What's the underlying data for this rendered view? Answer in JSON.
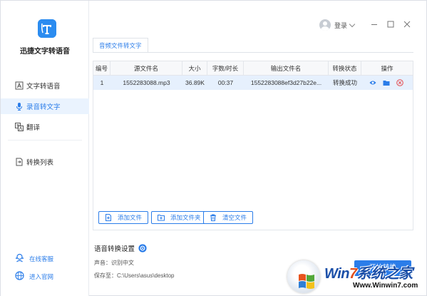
{
  "app": {
    "name": "迅捷文字转语音"
  },
  "sidebar": {
    "items": [
      {
        "label": "文字转语音",
        "icon": "text-to-speech-icon",
        "active": false
      },
      {
        "label": "录音转文字",
        "icon": "microphone-icon",
        "active": true
      },
      {
        "label": "翻译",
        "icon": "translate-icon",
        "active": false
      },
      {
        "label": "转换列表",
        "icon": "conversion-list-icon",
        "active": false
      }
    ],
    "links": [
      {
        "label": "在线客服",
        "icon": "customer-service-icon"
      },
      {
        "label": "进入官网",
        "icon": "globe-icon"
      }
    ]
  },
  "titlebar": {
    "login_label": "登录"
  },
  "tabs": [
    {
      "label": "音频文件转文字"
    }
  ],
  "table": {
    "headers": [
      "编号",
      "源文件名",
      "大小",
      "字数/时长",
      "输出文件名",
      "转换状态",
      "操作"
    ],
    "rows": [
      {
        "id": "1",
        "source": "1552283088.mp3",
        "size": "36.89K",
        "duration": "00:37",
        "output": "1552283088ef3d27b22e...",
        "status": "转换成功"
      }
    ]
  },
  "buttons": {
    "add_file": "添加文件",
    "add_folder": "添加文件夹",
    "clear_files": "清空文件"
  },
  "settings": {
    "title": "语音转换设置",
    "voice_label": "声音：",
    "voice_value": "识别中文",
    "save_label": "保存至：",
    "save_value": "C:\\Users\\asus\\desktop",
    "start_label": "开始转换"
  },
  "watermark": {
    "brand_a": "Win",
    "brand_b": "7",
    "brand_c": "系统之家",
    "url": "Www.Winwin7.com"
  },
  "colors": {
    "accent": "#2b7de9",
    "active_bg": "#eaf3fe",
    "row_highlight": "#e6f0fd",
    "delete": "#e5484d"
  }
}
